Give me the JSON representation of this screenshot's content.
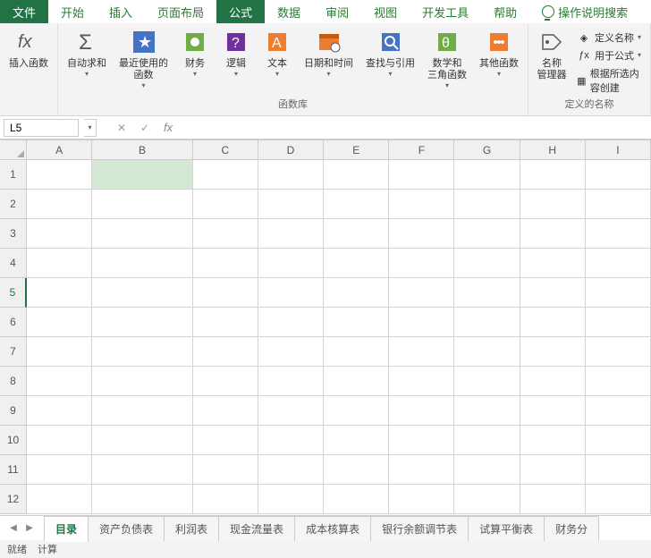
{
  "tabs": {
    "file": "文件",
    "home": "开始",
    "insert": "插入",
    "layout": "页面布局",
    "formula": "公式",
    "data": "数据",
    "review": "审阅",
    "view": "视图",
    "dev": "开发工具",
    "help": "帮助",
    "search": "操作说明搜索"
  },
  "ribbon": {
    "insert_fn": "插入函数",
    "autosum": "自动求和",
    "recent": "最近使用的\n函数",
    "financial": "财务",
    "logical": "逻辑",
    "text": "文本",
    "datetime": "日期和时间",
    "lookup": "查找与引用",
    "math": "数学和\n三角函数",
    "other": "其他函数",
    "lib_label": "函数库",
    "name_mgr": "名称\n管理器",
    "def_name": "定义名称",
    "use_in": "用于公式",
    "from_sel": "根据所选内容创建",
    "names_label": "定义的名称"
  },
  "namebox": "L5",
  "columns": [
    "A",
    "B",
    "C",
    "D",
    "E",
    "F",
    "G",
    "H",
    "I"
  ],
  "rows": [
    "1",
    "2",
    "3",
    "4",
    "5",
    "6",
    "7",
    "8",
    "9",
    "10",
    "11",
    "12"
  ],
  "sheets": [
    "目录",
    "资产负债表",
    "利润表",
    "现金流量表",
    "成本核算表",
    "银行余额调节表",
    "试算平衡表",
    "财务分"
  ],
  "status": {
    "ready": "就绪",
    "calc": "计算"
  }
}
